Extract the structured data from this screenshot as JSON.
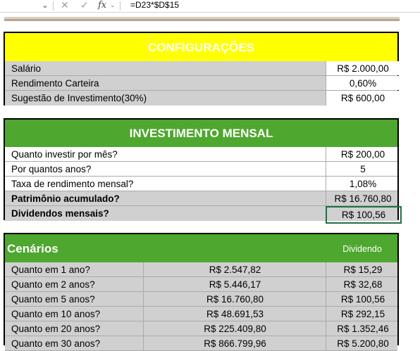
{
  "formula_bar": {
    "formula": "=D23*$D$15",
    "fx": "fx",
    "cancel_icon": "✕",
    "enter_icon": "✓"
  },
  "config": {
    "title": "CONFIGURAÇÕES",
    "rows": [
      {
        "label": "Salário",
        "value": "R$ 2.000,00"
      },
      {
        "label": "Rendimento Carteira",
        "value": "0,60%"
      },
      {
        "label": "Sugestão de Investimento(30%)",
        "value": "R$ 600,00"
      }
    ]
  },
  "investimento": {
    "title": "INVESTIMENTO MENSAL",
    "rows": [
      {
        "label": "Quanto investir por mês?",
        "value": "R$ 200,00"
      },
      {
        "label": "Por quantos anos?",
        "value": "5"
      },
      {
        "label": "Taxa de rendimento mensal?",
        "value": "1,08%"
      },
      {
        "label": "Patrimônio acumulado?",
        "value": "R$ 16.760,80"
      },
      {
        "label": "Dividendos mensais?",
        "value": "R$ 100,56"
      }
    ]
  },
  "cenarios": {
    "title": "Cenários",
    "dividend_header": "Dividendo",
    "rows": [
      {
        "label": "Quanto em 1 ano?",
        "patrimonio": "R$ 2.547,82",
        "dividendo": "R$ 15,29"
      },
      {
        "label": "Quanto em 2 anos?",
        "patrimonio": "R$ 5.446,17",
        "dividendo": "R$ 32,68"
      },
      {
        "label": "Quanto em 5 anos?",
        "patrimonio": "R$ 16.760,80",
        "dividendo": "R$ 100,56"
      },
      {
        "label": "Quanto em 10 anos?",
        "patrimonio": "R$ 48.691,53",
        "dividendo": "R$ 292,15"
      },
      {
        "label": "Quanto em 20 anos?",
        "patrimonio": "R$ 225.409,80",
        "dividendo": "R$ 1.352,46"
      },
      {
        "label": "Quanto em 30 anos?",
        "patrimonio": "R$ 866.799,96",
        "dividendo": "R$ 5.200,80"
      }
    ]
  },
  "colors": {
    "config_header": "#ffff00",
    "green_header": "#4ea72e",
    "gray_cell": "#d0d0d0"
  }
}
